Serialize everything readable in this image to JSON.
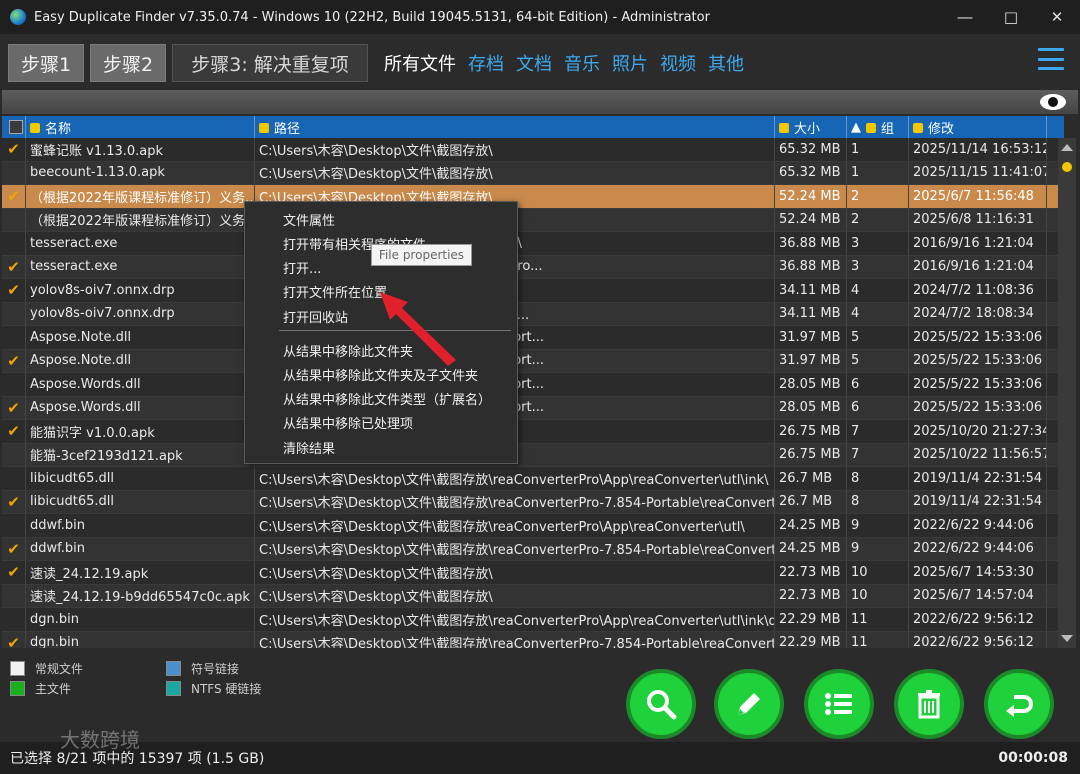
{
  "window": {
    "title": "Easy Duplicate Finder v7.35.0.74 - Windows 10 (22H2, Build 19045.5131, 64-bit Edition) - Administrator"
  },
  "steps": [
    "步骤1",
    "步骤2",
    "步骤3: 解决重复项"
  ],
  "file_tabs": [
    "所有文件",
    "存档",
    "文档",
    "音乐",
    "照片",
    "视频",
    "其他"
  ],
  "columns": {
    "name": "名称",
    "path": "路径",
    "size": "大小",
    "group": "组",
    "modified": "修改"
  },
  "rows": [
    {
      "checked": true,
      "name": "蜜蜂记账 v1.13.0.apk",
      "path": "C:\\Users\\木容\\Desktop\\文件\\截图存放\\",
      "size": "65.32 MB",
      "group": "1",
      "modified": "2025/11/14 16:53:12"
    },
    {
      "checked": false,
      "name": "beecount-1.13.0.apk",
      "path": "C:\\Users\\木容\\Desktop\\文件\\截图存放\\",
      "size": "65.32 MB",
      "group": "1",
      "modified": "2025/11/15 11:41:07"
    },
    {
      "checked": true,
      "name": "（根据2022年版课程标准修订）义务...",
      "path": "C:\\Users\\木容\\Desktop\\文件\\截图存放\\",
      "size": "52.24 MB",
      "group": "2",
      "modified": "2025/6/7 11:56:48"
    },
    {
      "checked": false,
      "name": "（根据2022年版课程标准修订）义务...",
      "path": "",
      "size": "52.24 MB",
      "group": "2",
      "modified": "2025/6/8 11:16:31"
    },
    {
      "checked": false,
      "name": "tesseract.exe",
      "path": "verterPro\\Data\\reaConverter7\\tesseract\\",
      "size": "36.88 MB",
      "group": "3",
      "modified": "2016/9/16 1:21:04"
    },
    {
      "checked": true,
      "name": "tesseract.exe",
      "path": "verterPro-7.854-Portable\\reaConverterPro...",
      "size": "36.88 MB",
      "group": "3",
      "modified": "2016/9/16 1:21:04"
    },
    {
      "checked": true,
      "name": "yolov8s-oiv7.onnx.drp",
      "path": "图模型) 解压覆盖软件模型默认路径(Ai 抠...",
      "size": "34.11 MB",
      "group": "4",
      "modified": "2024/7/2 11:08:36"
    },
    {
      "checked": false,
      "name": "yolov8s-oiv7.onnx.drp",
      "path": "Image Matting v2.3 便捷版\\Aiarty Image...",
      "size": "34.11 MB",
      "group": "4",
      "modified": "2024/7/2 18:08:34"
    },
    {
      "checked": false,
      "name": "Aspose.Note.dll",
      "path": "ator Pro-9.3.3520-Portable\\FileLocatorPort...",
      "size": "31.97 MB",
      "group": "5",
      "modified": "2025/5/22 15:33:06"
    },
    {
      "checked": true,
      "name": "Aspose.Note.dll",
      "path": "ator Pro-9.3.3520-Portable\\FileLocatorPort...",
      "size": "31.97 MB",
      "group": "5",
      "modified": "2025/5/22 15:33:06"
    },
    {
      "checked": false,
      "name": "Aspose.Words.dll",
      "path": "ator Pro-9.3.3520-Portable\\FileLocatorPort...",
      "size": "28.05 MB",
      "group": "6",
      "modified": "2025/5/22 15:33:06"
    },
    {
      "checked": true,
      "name": "Aspose.Words.dll",
      "path": "ator Pro-9.3.3520-Portable\\FileLocatorPort...",
      "size": "28.05 MB",
      "group": "6",
      "modified": "2025/5/22 15:33:06"
    },
    {
      "checked": true,
      "name": "能猫识字 v1.0.0.apk",
      "path": "",
      "size": "26.75 MB",
      "group": "7",
      "modified": "2025/10/20 21:27:34"
    },
    {
      "checked": false,
      "name": "能猫-3cef2193d121.apk",
      "path": "",
      "size": "26.75 MB",
      "group": "7",
      "modified": "2025/10/22 11:56:57"
    },
    {
      "checked": false,
      "name": "libicudt65.dll",
      "path": "C:\\Users\\木容\\Desktop\\文件\\截图存放\\reaConverterPro\\App\\reaConverter\\utl\\ink\\",
      "size": "26.7 MB",
      "group": "8",
      "modified": "2019/11/4 22:31:54"
    },
    {
      "checked": true,
      "name": "libicudt65.dll",
      "path": "C:\\Users\\木容\\Desktop\\文件\\截图存放\\reaConverterPro-7.854-Portable\\reaConverterPro...",
      "size": "26.7 MB",
      "group": "8",
      "modified": "2019/11/4 22:31:54"
    },
    {
      "checked": false,
      "name": "ddwf.bin",
      "path": "C:\\Users\\木容\\Desktop\\文件\\截图存放\\reaConverterPro\\App\\reaConverter\\utl\\",
      "size": "24.25 MB",
      "group": "9",
      "modified": "2022/6/22 9:44:06"
    },
    {
      "checked": true,
      "name": "ddwf.bin",
      "path": "C:\\Users\\木容\\Desktop\\文件\\截图存放\\reaConverterPro-7.854-Portable\\reaConverterPro...",
      "size": "24.25 MB",
      "group": "9",
      "modified": "2022/6/22 9:44:06"
    },
    {
      "checked": true,
      "name": "速读_24.12.19.apk",
      "path": "C:\\Users\\木容\\Desktop\\文件\\截图存放\\",
      "size": "22.73 MB",
      "group": "10",
      "modified": "2025/6/7 14:53:30"
    },
    {
      "checked": false,
      "name": "速读_24.12.19-b9dd65547c0c.apk",
      "path": "C:\\Users\\木容\\Desktop\\文件\\截图存放\\",
      "size": "22.73 MB",
      "group": "10",
      "modified": "2025/6/7 14:57:04"
    },
    {
      "checked": false,
      "name": "dgn.bin",
      "path": "C:\\Users\\木容\\Desktop\\文件\\截图存放\\reaConverterPro\\App\\reaConverter\\utl\\ink\\data2\\",
      "size": "22.29 MB",
      "group": "11",
      "modified": "2022/6/22 9:56:12"
    },
    {
      "checked": true,
      "name": "dgn.bin",
      "path": "C:\\Users\\木容\\Desktop\\文件\\截图存放\\reaConverterPro-7.854-Portable\\reaConverterPro...",
      "size": "22.29 MB",
      "group": "11",
      "modified": "2022/6/22 9:56:12"
    }
  ],
  "selected_row_index": 2,
  "context_menu": {
    "items_top": [
      "文件属性",
      "打开带有相关程序的文件",
      "打开...",
      "打开文件所在位置",
      "打开回收站"
    ],
    "items_bottom": [
      "从结果中移除此文件夹",
      "从结果中移除此文件夹及子文件夹",
      "从结果中移除此文件类型（扩展名）",
      "从结果中移除已处理项",
      "清除结果"
    ]
  },
  "tooltip": "File properties",
  "legend": {
    "regular": "常规文件",
    "master": "主文件",
    "symlink": "符号链接",
    "hardlink": "NTFS 硬链接"
  },
  "status": {
    "text": "已选择 8/21 项中的 15397 项   (1.5 GB)",
    "time": "00:00:08"
  },
  "watermark": "大数跨境",
  "colors": {
    "header_blue": "#1766b5",
    "selected_row": "#c98a4b",
    "accent_green": "#1fd13a",
    "tab_blue": "#3ea8ef",
    "check_orange": "#f3a400"
  }
}
